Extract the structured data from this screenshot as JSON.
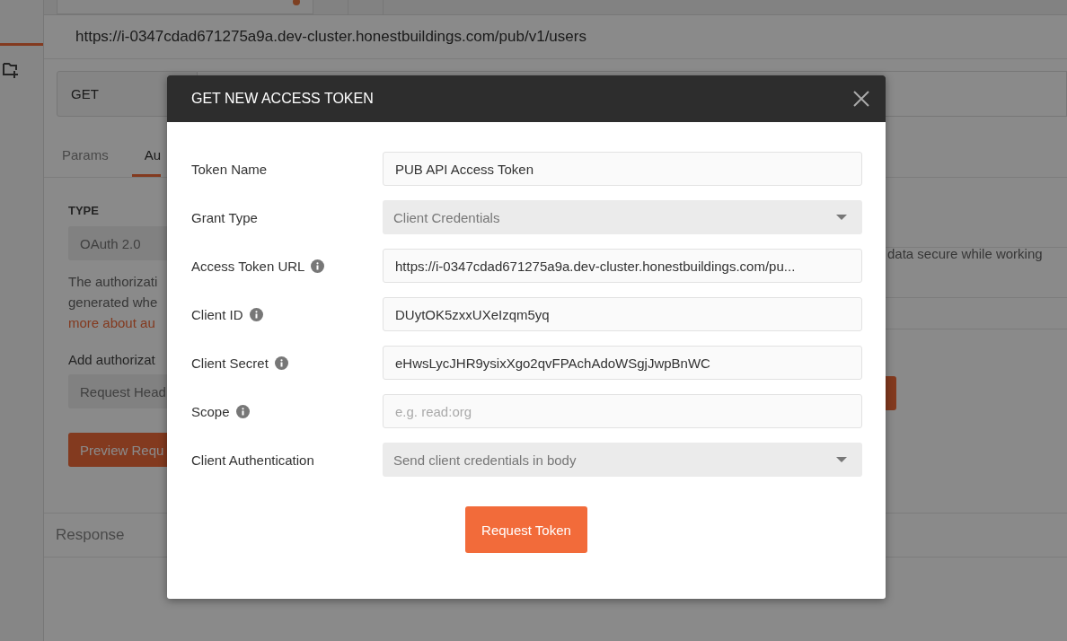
{
  "request": {
    "url_title": "https://i-0347cdad671275a9a.dev-cluster.honestbuildings.com/pub/v1/users",
    "method": "GET"
  },
  "tabs": [
    {
      "label": "Params",
      "selected": false
    },
    {
      "label": "Au",
      "selected": true
    }
  ],
  "auth": {
    "type_label": "TYPE",
    "type_value": "OAuth 2.0",
    "description": [
      "The authorizati",
      "generated whe"
    ],
    "link": "more about au",
    "add_label": "Add authorizat",
    "add_value": "Request Head",
    "preview_button": "Preview Requ"
  },
  "notice": "data secure while working",
  "response_label": "Response",
  "dialog": {
    "title": "GET NEW ACCESS TOKEN",
    "fields": [
      {
        "label": "Token Name",
        "kind": "text",
        "info": false,
        "value": "PUB API Access Token"
      },
      {
        "label": "Grant Type",
        "kind": "select",
        "info": false,
        "value": "Client Credentials"
      },
      {
        "label": "Access Token URL",
        "kind": "text",
        "info": true,
        "value": "https://i-0347cdad671275a9a.dev-cluster.honestbuildings.com/pu..."
      },
      {
        "label": "Client ID",
        "kind": "text",
        "info": true,
        "value": "DUytOK5zxxUXeIzqm5yq"
      },
      {
        "label": "Client Secret",
        "kind": "text",
        "info": true,
        "value": "eHwsLycJHR9ysixXgo2qvFPAchAdoWSgjJwpBnWC"
      },
      {
        "label": "Scope",
        "kind": "text",
        "info": true,
        "placeholder": "e.g. read:org"
      },
      {
        "label": "Client Authentication",
        "kind": "select",
        "info": false,
        "value": "Send client credentials in body"
      }
    ],
    "button": "Request Token"
  }
}
